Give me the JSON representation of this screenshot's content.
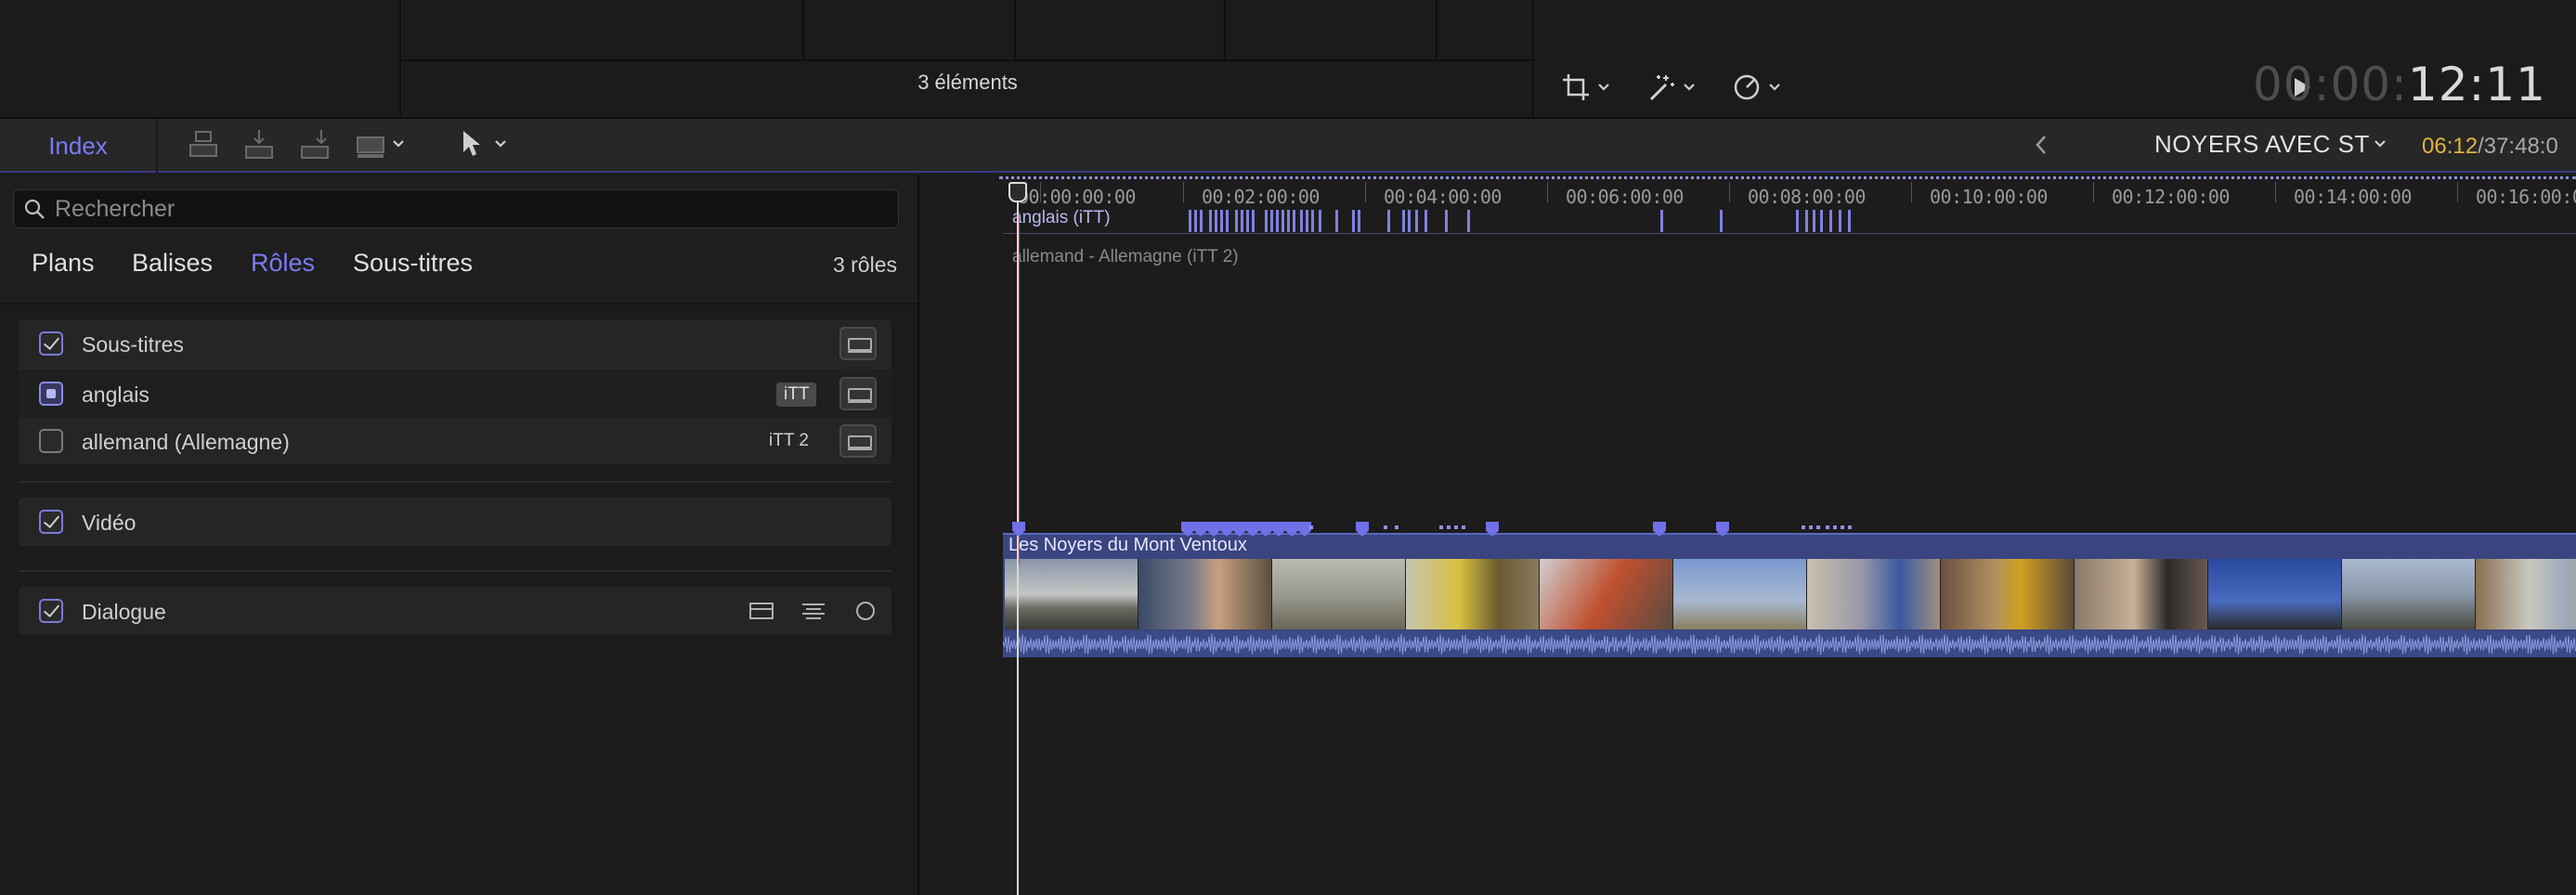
{
  "browser": {
    "elements_count": "3 éléments"
  },
  "viewer": {
    "timecode_dim": "00:00:",
    "timecode_bright": "12:11"
  },
  "toolbar": {
    "index_label": "Index",
    "project_name": "NOYERS AVEC ST",
    "duration_current": "06:12",
    "duration_total": "/37:48:0"
  },
  "search": {
    "placeholder": "Rechercher",
    "value": ""
  },
  "tabs": [
    {
      "label": "Plans"
    },
    {
      "label": "Balises"
    },
    {
      "label": "Rôles"
    },
    {
      "label": "Sous-titres"
    }
  ],
  "roles_count": "3 rôles",
  "roles": {
    "subtitles": {
      "label": "Sous-titres"
    },
    "anglais": {
      "label": "anglais",
      "format": "iTT"
    },
    "allemand": {
      "label": "allemand (Allemagne)",
      "format": "iTT 2"
    },
    "video": {
      "label": "Vidéo"
    },
    "dialogue": {
      "label": "Dialogue"
    }
  },
  "timeline": {
    "ruler": [
      "00:00:00:00",
      "00:02:00:00",
      "00:04:00:00",
      "00:06:00:00",
      "00:08:00:00",
      "00:10:00:00",
      "00:12:00:00",
      "00:14:00:00",
      "00:16:00:00"
    ],
    "lane1_label": "anglais (iTT)",
    "lane2_label": "allemand - Allemagne (iTT 2)",
    "clip_title": "Les Noyers du Mont Ventoux"
  },
  "colors": {
    "accent": "#7b7bf5",
    "playhead_red": "#d03c3c",
    "clip_bg": "#3a4580"
  }
}
